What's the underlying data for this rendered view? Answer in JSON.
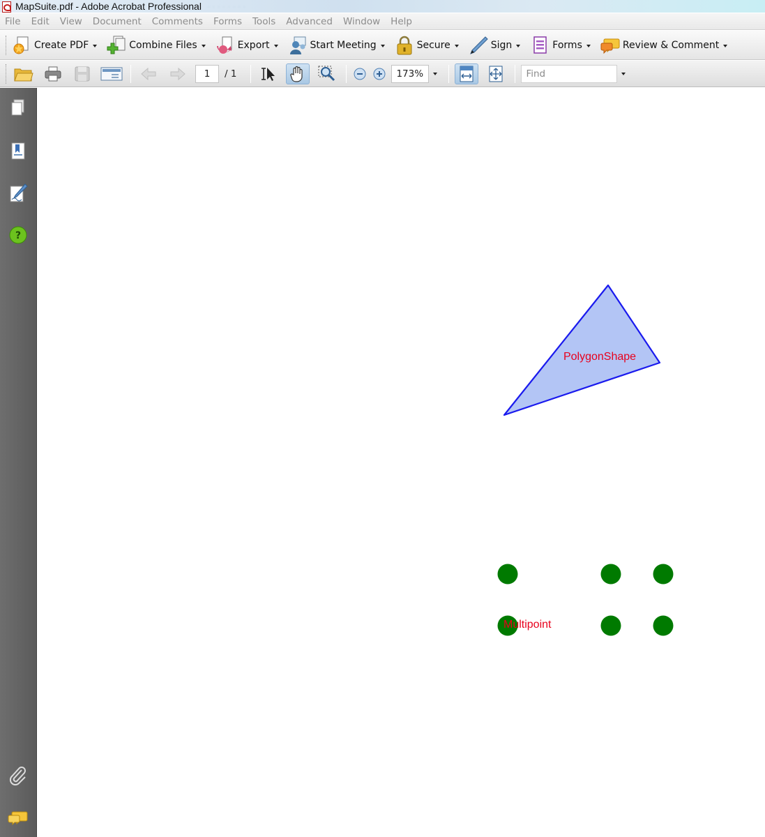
{
  "window": {
    "title": "MapSuite.pdf - Adobe Acrobat Professional"
  },
  "menubar": {
    "items": [
      "File",
      "Edit",
      "View",
      "Document",
      "Comments",
      "Forms",
      "Tools",
      "Advanced",
      "Window",
      "Help"
    ]
  },
  "tasks": {
    "items": [
      {
        "label": "Create PDF",
        "icon": "create-pdf-icon"
      },
      {
        "label": "Combine Files",
        "icon": "combine-files-icon"
      },
      {
        "label": "Export",
        "icon": "export-icon"
      },
      {
        "label": "Start Meeting",
        "icon": "start-meeting-icon"
      },
      {
        "label": "Secure",
        "icon": "lock-icon"
      },
      {
        "label": "Sign",
        "icon": "pen-icon"
      },
      {
        "label": "Forms",
        "icon": "forms-icon"
      },
      {
        "label": "Review & Comment",
        "icon": "review-comment-icon"
      }
    ]
  },
  "toolbar": {
    "page_current": "1",
    "page_total": "/ 1",
    "zoom": "173%",
    "find_placeholder": "Find",
    "active_tool": "hand-tool"
  },
  "leftpane": {
    "icons": [
      "pages-icon",
      "bookmarks-icon",
      "signatures-icon",
      "help-icon",
      "attachments-icon",
      "comments-icon"
    ]
  },
  "document": {
    "polygon_label": "PolygonShape",
    "multipoint_label": "Multipoint",
    "colors": {
      "polygon_fill": "#b3c5f5",
      "polygon_stroke": "#1a1aee",
      "point_fill": "#007a00",
      "label": "#e8001c"
    }
  }
}
